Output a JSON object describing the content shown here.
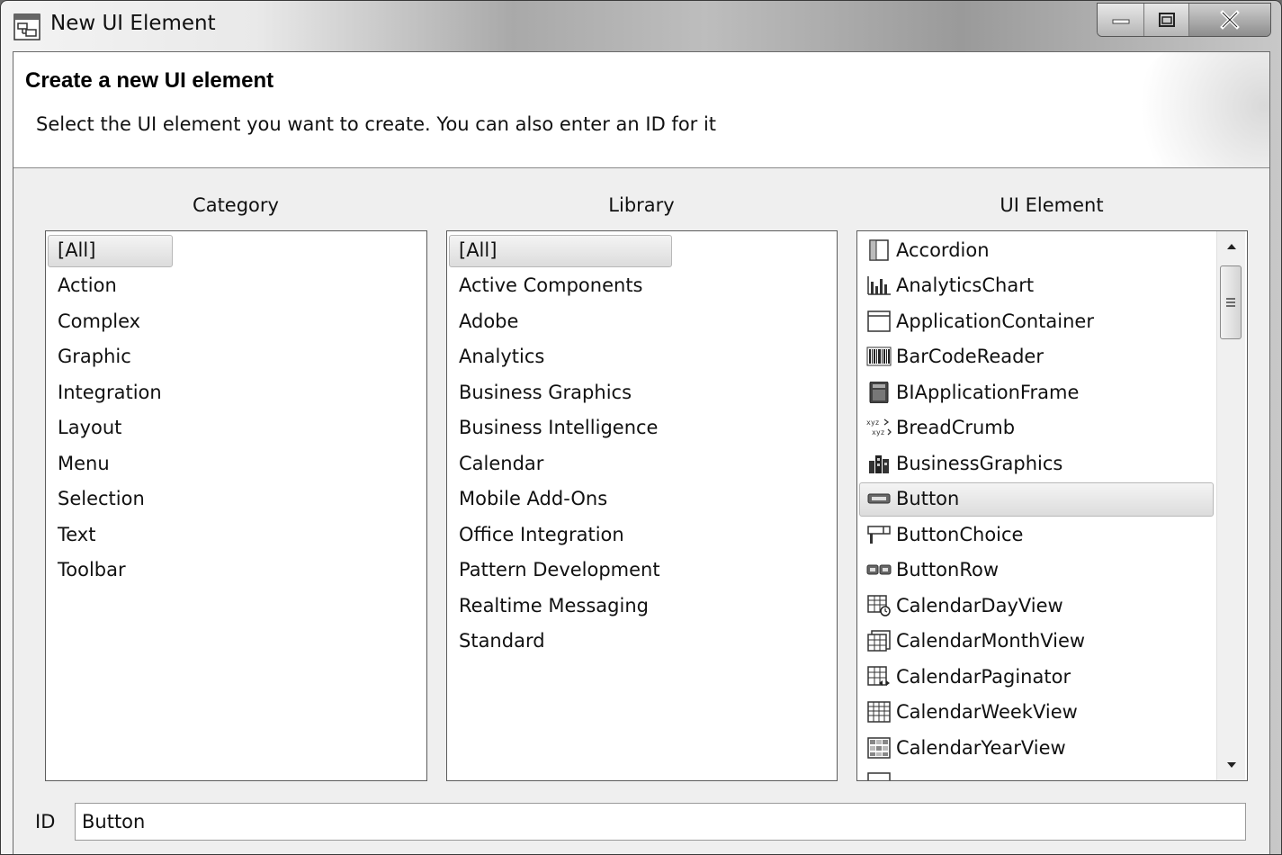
{
  "window": {
    "title": "New UI Element"
  },
  "header": {
    "title": "Create a new UI element",
    "subtitle": "Select the UI element you want to create. You can also enter an ID for it"
  },
  "columns": {
    "category_label": "Category",
    "library_label": "Library",
    "ui_element_label": "UI Element"
  },
  "category": {
    "selected": "[All]",
    "items": [
      "[All]",
      "Action",
      "Complex",
      "Graphic",
      "Integration",
      "Layout",
      "Menu",
      "Selection",
      "Text",
      "Toolbar"
    ]
  },
  "library": {
    "selected": "[All]",
    "items": [
      "[All]",
      "Active Components",
      "Adobe",
      "Analytics",
      "Business Graphics",
      "Business Intelligence",
      "Calendar",
      "Mobile Add-Ons",
      "Office Integration",
      "Pattern Development",
      "Realtime Messaging",
      "Standard"
    ]
  },
  "ui_element": {
    "selected": "Button",
    "items": [
      {
        "label": "Accordion",
        "icon": "accordion-icon"
      },
      {
        "label": "AnalyticsChart",
        "icon": "analytics-chart-icon"
      },
      {
        "label": "ApplicationContainer",
        "icon": "application-container-icon"
      },
      {
        "label": "BarCodeReader",
        "icon": "barcode-icon"
      },
      {
        "label": "BIApplicationFrame",
        "icon": "bi-application-frame-icon"
      },
      {
        "label": "BreadCrumb",
        "icon": "breadcrumb-icon"
      },
      {
        "label": "BusinessGraphics",
        "icon": "business-graphics-icon"
      },
      {
        "label": "Button",
        "icon": "button-icon"
      },
      {
        "label": "ButtonChoice",
        "icon": "button-choice-icon"
      },
      {
        "label": "ButtonRow",
        "icon": "button-row-icon"
      },
      {
        "label": "CalendarDayView",
        "icon": "calendar-day-view-icon"
      },
      {
        "label": "CalendarMonthView",
        "icon": "calendar-month-view-icon"
      },
      {
        "label": "CalendarPaginator",
        "icon": "calendar-paginator-icon"
      },
      {
        "label": "CalendarWeekView",
        "icon": "calendar-week-view-icon"
      },
      {
        "label": "CalendarYearView",
        "icon": "calendar-year-view-icon"
      }
    ]
  },
  "id_field": {
    "label": "ID",
    "value": "Button"
  }
}
